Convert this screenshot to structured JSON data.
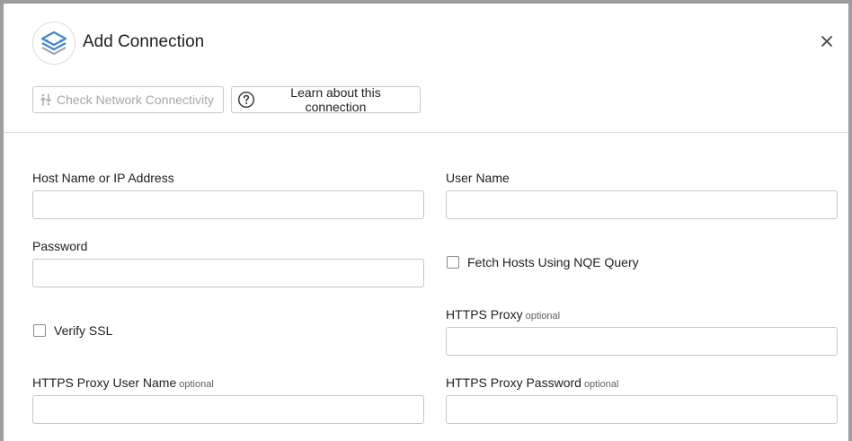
{
  "dialog": {
    "title": "Add Connection",
    "logo_icon": "layers-connection-icon",
    "close_icon": "close-icon"
  },
  "toolbar": {
    "check_label": "Check Network Connectivity",
    "check_icon": "network-check-icon",
    "check_disabled": true,
    "learn_label": "Learn about this connection",
    "learn_icon": "help-circle-icon"
  },
  "form": {
    "host": {
      "label": "Host Name or IP Address",
      "value": ""
    },
    "user": {
      "label": "User Name",
      "value": ""
    },
    "password": {
      "label": "Password",
      "value": ""
    },
    "fetch_hosts": {
      "label": "Fetch Hosts Using NQE Query",
      "checked": false
    },
    "verify_ssl": {
      "label": "Verify SSL",
      "checked": false
    },
    "https_proxy": {
      "label": "HTTPS Proxy",
      "optional": "optional",
      "value": ""
    },
    "proxy_user": {
      "label": "HTTPS Proxy User Name",
      "optional": "optional",
      "value": ""
    },
    "proxy_password": {
      "label": "HTTPS Proxy Password",
      "optional": "optional",
      "value": ""
    }
  },
  "colors": {
    "logo_blue": "#3f86d6",
    "logo_gray": "#9aa0a6",
    "disabled_text": "#a8a8a8"
  }
}
